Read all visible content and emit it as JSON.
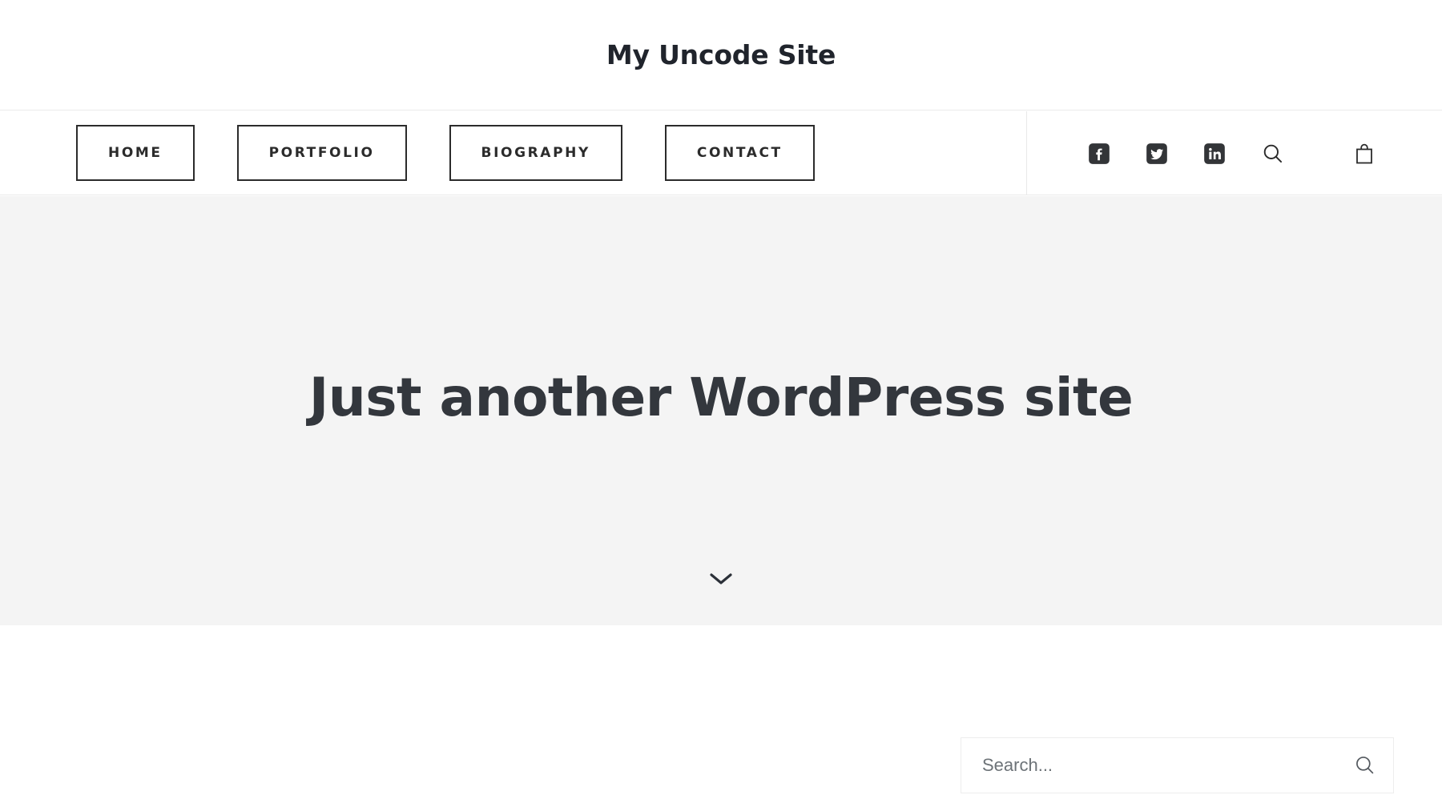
{
  "header": {
    "site_title": "My Uncode Site"
  },
  "nav": {
    "items": [
      {
        "label": "Home",
        "name": "home"
      },
      {
        "label": "Portfolio",
        "name": "portfolio"
      },
      {
        "label": "Biography",
        "name": "biography"
      },
      {
        "label": "Contact",
        "name": "contact"
      }
    ],
    "social": [
      {
        "icon": "facebook-icon",
        "label": "Facebook"
      },
      {
        "icon": "twitter-icon",
        "label": "Twitter"
      },
      {
        "icon": "linkedin-icon",
        "label": "LinkedIn"
      }
    ],
    "utilities": [
      {
        "icon": "search-icon",
        "label": "Search"
      },
      {
        "icon": "shopping-bag-icon",
        "label": "Cart"
      }
    ]
  },
  "hero": {
    "title": "Just another WordPress site",
    "scroll_indicator_icon": "chevron-down-icon"
  },
  "search_widget": {
    "placeholder": "Search...",
    "value": "",
    "submit_icon": "search-icon"
  },
  "colors": {
    "page_background": "#ffffff",
    "hero_background": "#f4f4f4",
    "text_dark": "#2b2b2b",
    "title_color": "#20242c",
    "hero_title_color": "#33373d",
    "social_icon_fill": "#333538",
    "border_light": "#e9e9e9",
    "placeholder_color": "#6d7378"
  }
}
